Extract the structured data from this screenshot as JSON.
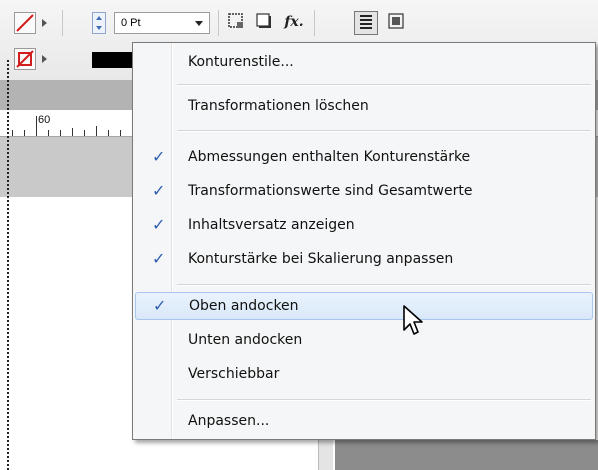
{
  "toolbar": {
    "stroke_weight_value": "0 Pt",
    "fx_label": "fx."
  },
  "ruler": {
    "marker": "60"
  },
  "context_menu": {
    "items": [
      {
        "label": "Konturenstile...",
        "checked": false,
        "highlighted": false
      },
      {
        "label": "Transformationen löschen",
        "checked": false,
        "highlighted": false
      },
      {
        "label": "Abmessungen enthalten Konturenstärke",
        "checked": true,
        "highlighted": false
      },
      {
        "label": "Transformationswerte sind Gesamtwerte",
        "checked": true,
        "highlighted": false
      },
      {
        "label": "Inhaltsversatz anzeigen",
        "checked": true,
        "highlighted": false
      },
      {
        "label": "Konturstärke bei Skalierung anpassen",
        "checked": true,
        "highlighted": false
      },
      {
        "label": "Oben andocken",
        "checked": true,
        "highlighted": true
      },
      {
        "label": "Unten andocken",
        "checked": false,
        "highlighted": false
      },
      {
        "label": "Verschiebbar",
        "checked": false,
        "highlighted": false
      },
      {
        "label": "Anpassen...",
        "checked": false,
        "highlighted": false
      }
    ],
    "check_glyph": "✓"
  },
  "colors": {
    "menu_background": "#f5f6f7",
    "highlight": "#d9e8f9",
    "check_mark": "#2f5faf",
    "stroke_none_red": "#d11f1f"
  }
}
